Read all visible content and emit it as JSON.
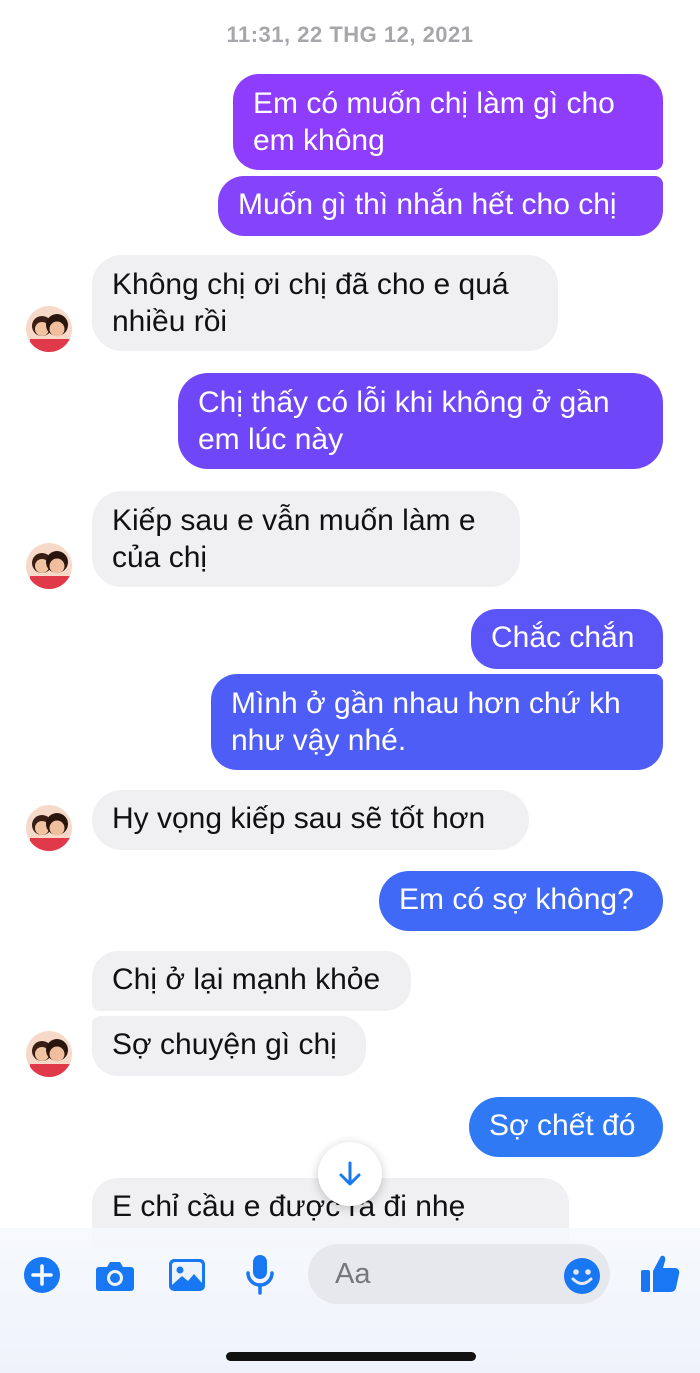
{
  "thread": {
    "timestamp": "11:31, 22 THG 12, 2021",
    "messages": [
      {
        "id": "m1",
        "direction": "outgoing",
        "text": "Em có muốn chị làm gì cho em không"
      },
      {
        "id": "m2",
        "direction": "outgoing",
        "text": "Muốn gì thì nhắn hết cho chị"
      },
      {
        "id": "m3",
        "direction": "incoming",
        "text": "Không chị ơi chị đã cho e quá nhiều rồi"
      },
      {
        "id": "m4",
        "direction": "outgoing",
        "text": "Chị thấy có lỗi khi không ở gần em lúc này"
      },
      {
        "id": "m5",
        "direction": "incoming",
        "text": "Kiếp sau e vẫn muốn làm e của chị"
      },
      {
        "id": "m6",
        "direction": "outgoing",
        "text": "Chắc chắn"
      },
      {
        "id": "m7",
        "direction": "outgoing",
        "text": "Mình ở gần nhau hơn chứ kh như vậy nhé."
      },
      {
        "id": "m8",
        "direction": "incoming",
        "text": "Hy vọng kiếp sau sẽ tốt hơn"
      },
      {
        "id": "m9",
        "direction": "outgoing",
        "text": "Em có sợ không?"
      },
      {
        "id": "m10",
        "direction": "incoming",
        "text": "Chị ở lại mạnh khỏe"
      },
      {
        "id": "m11",
        "direction": "incoming",
        "text": "Sợ chuyện gì chị"
      },
      {
        "id": "m12",
        "direction": "outgoing",
        "text": "Sợ chết đó"
      },
      {
        "id": "m13",
        "direction": "incoming",
        "text": "E chỉ cầu e được ra đi nhẹ"
      }
    ]
  },
  "composer": {
    "placeholder": "Aa",
    "icons": [
      "plus-icon",
      "camera-icon",
      "image-icon",
      "microphone-icon",
      "emoji-icon",
      "thumbs-up-icon"
    ]
  },
  "scroll_button": {
    "icon": "arrow-down-icon"
  },
  "colors": {
    "accent": "#1877f2",
    "outgoing_top": "#8a3ffc",
    "outgoing_mid": "#6f45f9",
    "outgoing_bottom": "#3d6bf6",
    "incoming_bg": "#f0f0f2",
    "timestamp": "#a7a7ab"
  }
}
